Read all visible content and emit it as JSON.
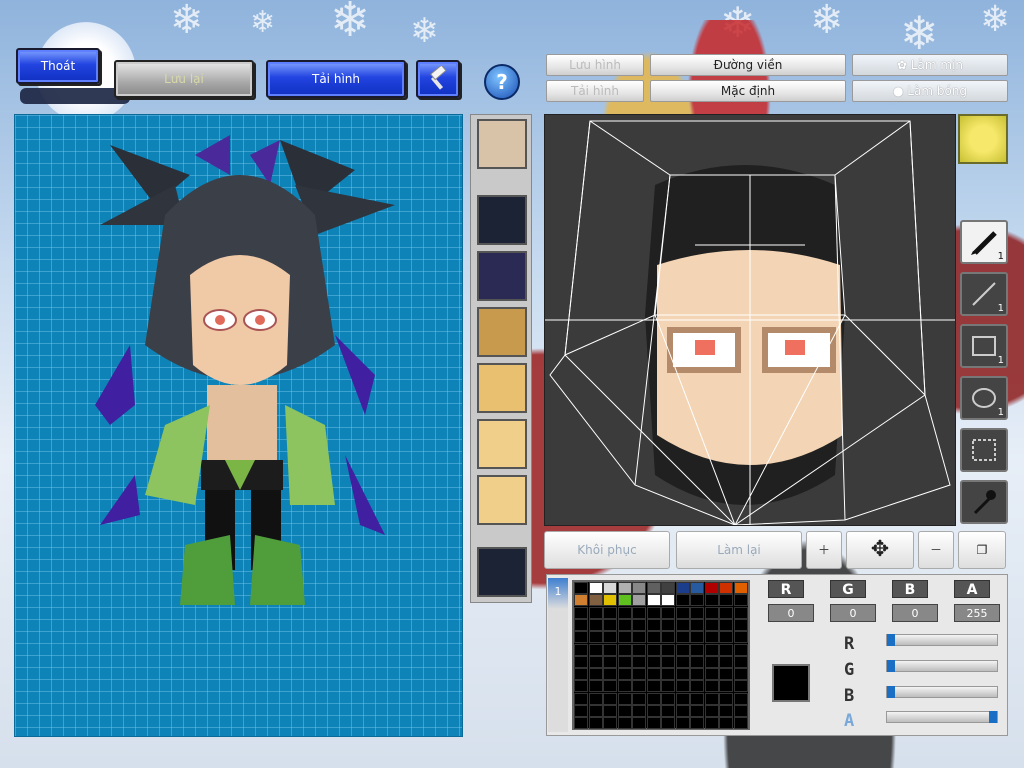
{
  "toolbar": {
    "exit_label": "Thoát",
    "save_label": "Lưu lại",
    "reload_label": "Tải hình"
  },
  "tabs": {
    "save_image": "Lưu hình",
    "load_image": "Tải hình",
    "outline": "Đường viền",
    "default": "Mặc định",
    "smooth": "Làm mịn",
    "shade": "Làm bóng"
  },
  "edit_actions": {
    "restore": "Khôi phục",
    "redo": "Làm lại"
  },
  "tools": [
    {
      "icon": "pen-icon",
      "count": "1"
    },
    {
      "icon": "line-icon",
      "count": "1"
    },
    {
      "icon": "rectangle-icon",
      "count": "1"
    },
    {
      "icon": "ellipse-icon",
      "count": "1"
    },
    {
      "icon": "selection-icon",
      "count": ""
    },
    {
      "icon": "eyedropper-icon",
      "count": ""
    }
  ],
  "color": {
    "channels": [
      "R",
      "G",
      "B",
      "A"
    ],
    "values": [
      "0",
      "0",
      "0",
      "255"
    ],
    "current_hex": "#000000",
    "sliders": {
      "r": 0,
      "g": 0,
      "b": 0,
      "a": 255
    }
  },
  "palette": {
    "swatches": [
      "#000000",
      "#ffffff",
      "#d8d8d8",
      "#b0b0b0",
      "#888888",
      "#606060",
      "#404040",
      "#1c3c8c",
      "#285aa0",
      "#b00000",
      "#d03000",
      "#e06000",
      "#d08030",
      "#806040",
      "#e0c000",
      "#60c020",
      "#a0a0a0",
      "#ffffff",
      "#ffffff"
    ]
  },
  "colors": {
    "canvas_bg": "#0d83b8",
    "editor_bg": "#3b3b3b",
    "accent_blue": "#2244e0"
  }
}
